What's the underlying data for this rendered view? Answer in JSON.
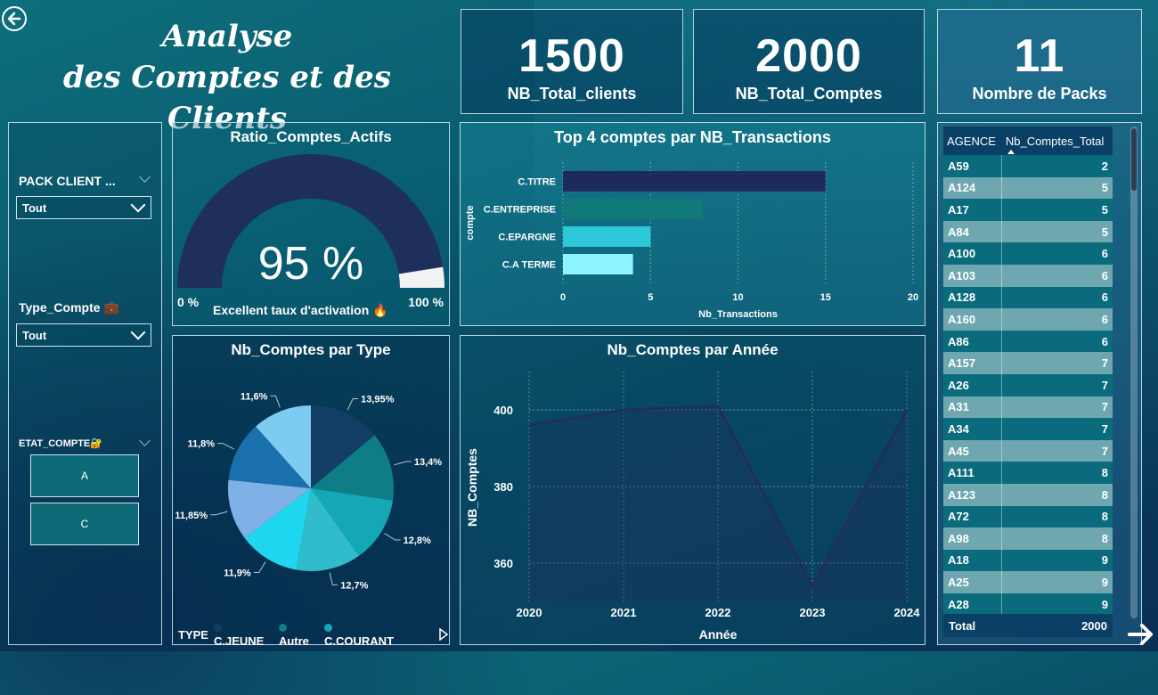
{
  "header": {
    "title_line1": "Analyse",
    "title_line2": "des Comptes et des Clients"
  },
  "kpis": [
    {
      "value": "1500",
      "label": "NB_Total_clients"
    },
    {
      "value": "2000",
      "label": "NB_Total_Comptes"
    },
    {
      "value": "11",
      "label": "Nombre de Packs"
    }
  ],
  "filters": {
    "pack": {
      "label": "PACK CLIENT ...",
      "value": "Tout"
    },
    "type": {
      "label": "Type_Compte",
      "value": "Tout",
      "emoji": "💼"
    },
    "etat": {
      "label": "ETAT_COMPTE",
      "emoji": "🔐",
      "options": [
        "A",
        "C"
      ]
    }
  },
  "gauge": {
    "title": "Ratio_Comptes_Actifs",
    "value_text": "95 %",
    "value": 95,
    "min_label": "0 %",
    "max_label": "100 %",
    "caption": "Excellent taux d'activation 🔥",
    "colors": {
      "fill": "#1f2f5c",
      "rest": "#f2f2f2"
    }
  },
  "bar_chart": {
    "title": "Top 4 comptes par NB_Transactions",
    "ylabel": "compte",
    "xlabel": "Nb_Transactions"
  },
  "pie_chart": {
    "title": "Nb_Comptes par Type",
    "legend_title": "TYPE",
    "legend": [
      "C.JEUNE",
      "Autre",
      "C.COURANT"
    ]
  },
  "line_chart": {
    "title": "Nb_Comptes par Année",
    "xlabel": "Année",
    "ylabel": "NB_Comptes"
  },
  "chart_data": [
    {
      "type": "bar",
      "title": "Top 4 comptes par NB_Transactions",
      "categories": [
        "C.TITRE",
        "C.ENTREPRISE",
        "C.EPARGNE",
        "C.A TERME"
      ],
      "values": [
        15,
        8,
        5,
        4
      ],
      "colors": [
        "#1f2a5c",
        "#117a78",
        "#2ec8d8",
        "#8ef4ff"
      ],
      "xlabel": "Nb_Transactions",
      "ylabel": "compte",
      "xlim": [
        0,
        20
      ],
      "xticks": [
        "0",
        "5",
        "10",
        "15",
        "20"
      ],
      "grid": true
    },
    {
      "type": "pie",
      "title": "Nb_Comptes par Type",
      "labels": [
        "13,95%",
        "13,4%",
        "12,8%",
        "12,7%",
        "11,9%",
        "11,85%",
        "11,8%",
        "11,6%"
      ],
      "values": [
        13.95,
        13.4,
        12.8,
        12.7,
        11.9,
        11.85,
        11.8,
        11.6
      ],
      "colors": [
        "#123e66",
        "#0e7d86",
        "#14a7b5",
        "#31bccb",
        "#1ed7ee",
        "#7fb0e6",
        "#1a70ac",
        "#7ecbf2"
      ],
      "legend": [
        "C.JEUNE",
        "Autre",
        "C.COURANT"
      ]
    },
    {
      "type": "area",
      "title": "Nb_Comptes par Année",
      "x": [
        "2020",
        "2021",
        "2022",
        "2023",
        "2024"
      ],
      "values": [
        396,
        400,
        401,
        354,
        400
      ],
      "ylim": [
        350,
        410
      ],
      "yticks": [
        "360",
        "380",
        "400"
      ],
      "xlabel": "Année",
      "ylabel": "NB_Comptes",
      "grid": true,
      "color": "#1f2f5c"
    }
  ],
  "table": {
    "headers": [
      "AGENCE",
      "Nb_Comptes_Total"
    ],
    "rows": [
      [
        "A59",
        "2"
      ],
      [
        "A124",
        "5"
      ],
      [
        "A17",
        "5"
      ],
      [
        "A84",
        "5"
      ],
      [
        "A100",
        "6"
      ],
      [
        "A103",
        "6"
      ],
      [
        "A128",
        "6"
      ],
      [
        "A160",
        "6"
      ],
      [
        "A86",
        "6"
      ],
      [
        "A157",
        "7"
      ],
      [
        "A26",
        "7"
      ],
      [
        "A31",
        "7"
      ],
      [
        "A34",
        "7"
      ],
      [
        "A45",
        "7"
      ],
      [
        "A111",
        "8"
      ],
      [
        "A123",
        "8"
      ],
      [
        "A72",
        "8"
      ],
      [
        "A98",
        "8"
      ],
      [
        "A18",
        "9"
      ],
      [
        "A25",
        "9"
      ],
      [
        "A28",
        "9"
      ]
    ],
    "total_label": "Total",
    "total_value": "2000"
  }
}
